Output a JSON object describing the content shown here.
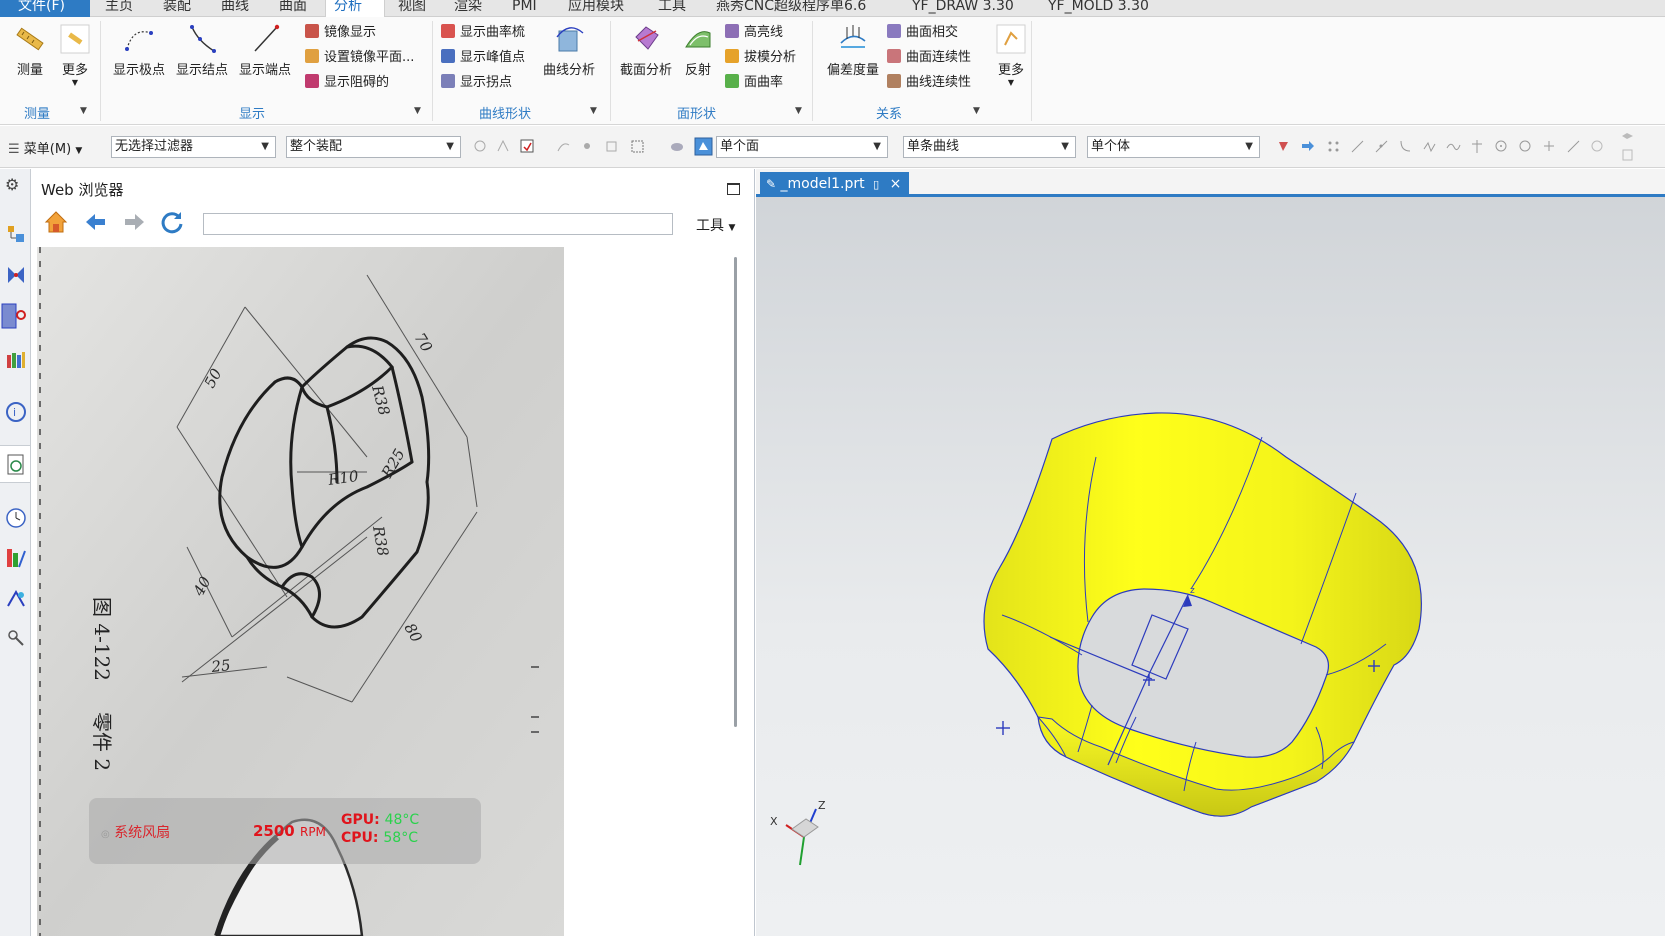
{
  "menu": {
    "tabs": [
      "文件(F)",
      "主页",
      "装配",
      "曲线",
      "曲面",
      "分析",
      "视图",
      "渲染",
      "PMI",
      "应用模块",
      "工具",
      "燕秀CNC超级程序单6.6",
      "YF_DRAW 3.30",
      "YF_MOLD 3.30"
    ],
    "active": "分析"
  },
  "ribbon": {
    "measure": {
      "btn_measure": "测量",
      "btn_more": "更多",
      "group": "测量"
    },
    "display": {
      "btn_poles": "显示极点",
      "btn_knots": "显示结点",
      "btn_endpoints": "显示端点",
      "item_mirror": "镜像显示",
      "item_set_mirror": "设置镜像平面...",
      "item_obstacles": "显示阻碍的",
      "group": "显示"
    },
    "curve_shape": {
      "item_comb": "显示曲率梳",
      "item_peaks": "显示峰值点",
      "item_inflect": "显示拐点",
      "btn_curve_analysis": "曲线分析",
      "group": "曲线形状"
    },
    "face_shape": {
      "btn_section": "截面分析",
      "btn_reflect": "反射",
      "item_highlight": "高亮线",
      "item_draft": "拔模分析",
      "item_curvature": "面曲率",
      "group": "面形状"
    },
    "relation": {
      "btn_deviation": "偏差度量",
      "item_intersect": "曲面相交",
      "item_face_cont": "曲面连续性",
      "item_curve_cont": "曲线连续性",
      "btn_more": "更多",
      "group": "关系"
    }
  },
  "toolbar": {
    "menu_label": "菜单(M)",
    "filter": "无选择过滤器",
    "scope": "整个装配",
    "face_rule": "单个面",
    "curve_rule": "单条曲线",
    "body_rule": "单个体"
  },
  "web": {
    "title": "Web 浏览器",
    "url": "",
    "tools_label": "工具"
  },
  "photo": {
    "dims": {
      "d50": "50",
      "d70": "70",
      "r38a": "R38",
      "r25": "R25",
      "r10": "R10",
      "r38b": "R38",
      "d40": "40",
      "d80": "80",
      "d25": "25"
    },
    "caption_fig": "图 4-122",
    "caption_part": "零件 2"
  },
  "overlay": {
    "fan_label": "系统风扇",
    "rpm_value": "2500",
    "rpm_unit": "RPM",
    "gpu_label": "GPU:",
    "gpu_temp": "48°C",
    "cpu_label": "CPU:",
    "cpu_temp": "58°C"
  },
  "graphics": {
    "tab_label": "_model1.prt",
    "model_color": "#ffff1a",
    "edge_color": "#2c3bbd",
    "triad": {
      "x": "X",
      "z": "Z"
    }
  },
  "colors": {
    "accent": "#2e7bc4",
    "menu_bg": "#e6e6e6"
  }
}
